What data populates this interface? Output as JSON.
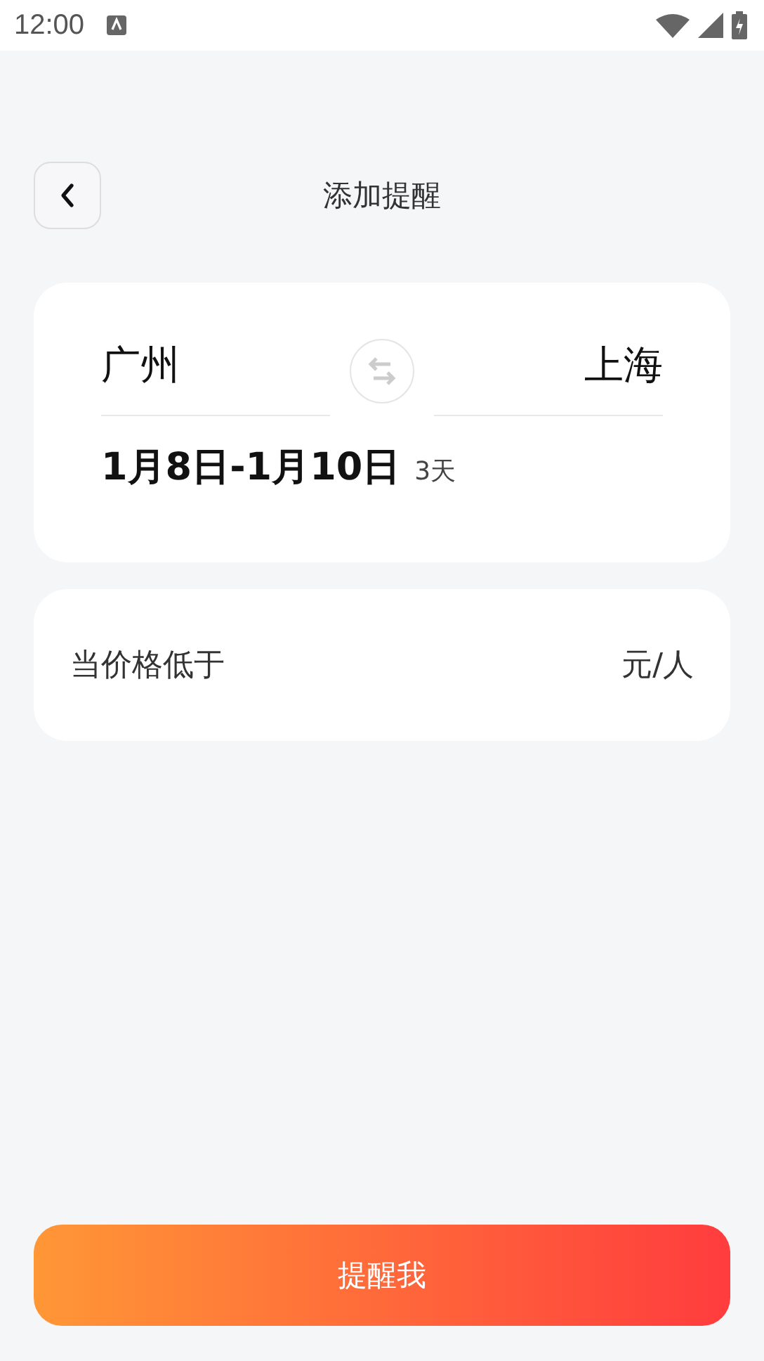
{
  "status_bar": {
    "time": "12:00"
  },
  "header": {
    "title": "添加提醒"
  },
  "route": {
    "from": "广州",
    "to": "上海",
    "dates": "1月8日-1月10日",
    "duration": "3天"
  },
  "price_alert": {
    "label": "当价格低于",
    "unit": "元/人"
  },
  "submit_button": {
    "label": "提醒我"
  }
}
